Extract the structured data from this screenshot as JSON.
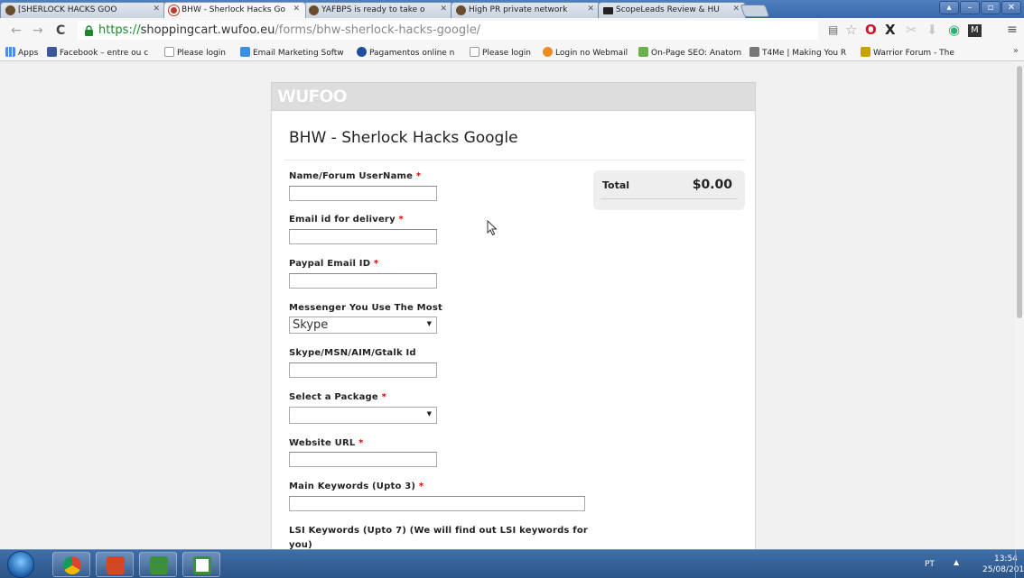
{
  "browser": {
    "tabs": [
      {
        "title": "[SHERLOCK HACKS GOO",
        "active": false,
        "favicon_color": "#6b4d2e"
      },
      {
        "title": "BHW - Sherlock Hacks Go",
        "active": true,
        "favicon_color": "#c0392b"
      },
      {
        "title": "YAFBPS is ready to take o",
        "active": false,
        "favicon_color": "#6b4d2e"
      },
      {
        "title": "High PR private network",
        "active": false,
        "favicon_color": "#6b4d2e"
      },
      {
        "title": "ScopeLeads Review & HU",
        "active": false,
        "favicon_color": "#222222"
      }
    ],
    "url_scheme": "https://",
    "url_host": "shoppingcart.wufoo.eu",
    "url_path": "/forms/bhw-sherlock-hacks-google/",
    "bookmarks": [
      {
        "label": "Apps",
        "icon": "apps-grid-icon",
        "color": "#555555"
      },
      {
        "label": "Facebook – entre ou c",
        "icon": "facebook-icon",
        "color": "#3b5998"
      },
      {
        "label": "Please login",
        "icon": "page-icon",
        "color": "#999999"
      },
      {
        "label": "Email Marketing Softw",
        "icon": "email-marketing-icon",
        "color": "#3a8ee6"
      },
      {
        "label": "Pagamentos online n",
        "icon": "paypal-icon",
        "color": "#1f4e9c"
      },
      {
        "label": "Please login",
        "icon": "page-icon",
        "color": "#999999"
      },
      {
        "label": "Login no Webmail",
        "icon": "cpanel-icon",
        "color": "#f08a24"
      },
      {
        "label": "On-Page SEO: Anatom",
        "icon": "seo-icon",
        "color": "#6ab04c"
      },
      {
        "label": "T4Me | Making You R",
        "icon": "t4me-icon",
        "color": "#777777"
      },
      {
        "label": "Warrior Forum - The",
        "icon": "warrior-forum-icon",
        "color": "#c8a000"
      }
    ],
    "bookmarks_more": "»"
  },
  "form": {
    "logo": "WUFOO",
    "title": "BHW - Sherlock Hacks Google",
    "fields": [
      {
        "label": "Name/Forum UserName",
        "required": true,
        "type": "text",
        "value": ""
      },
      {
        "label": "Email id for delivery",
        "required": true,
        "type": "text",
        "value": ""
      },
      {
        "label": "Paypal Email ID",
        "required": true,
        "type": "text",
        "value": ""
      },
      {
        "label": "Messenger You Use The Most",
        "required": false,
        "type": "select",
        "value": "Skype"
      },
      {
        "label": "Skype/MSN/AIM/Gtalk Id",
        "required": false,
        "type": "text",
        "value": ""
      },
      {
        "label": "Select a Package",
        "required": true,
        "type": "select",
        "value": ""
      },
      {
        "label": "Website URL",
        "required": true,
        "type": "text",
        "value": ""
      },
      {
        "label": "Main Keywords (Upto 3)",
        "required": true,
        "type": "text",
        "value": ""
      },
      {
        "label": "LSI Keywords (Upto 7) (We will find out LSI keywords for you)",
        "required": false,
        "type": "text",
        "value": ""
      }
    ],
    "required_mark": "*",
    "total": {
      "label": "Total",
      "amount": "$0.00"
    }
  },
  "taskbar": {
    "language": "PT",
    "time": "13:54",
    "date": "25/08/2016"
  },
  "colors": {
    "required": "#df0000",
    "taskbar": "#2b5487",
    "url_secure": "#1a8a2a"
  }
}
